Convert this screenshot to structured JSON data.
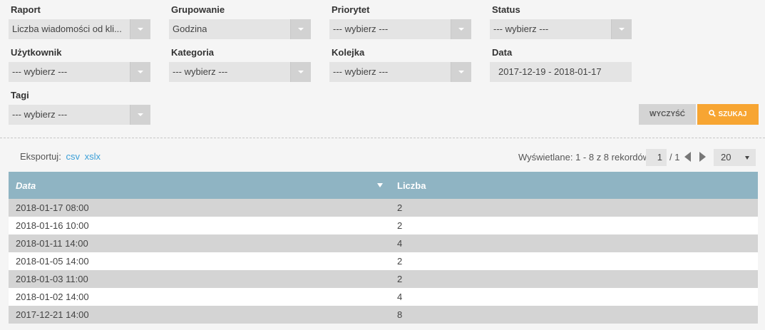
{
  "filters": {
    "raport": {
      "label": "Raport",
      "value": "Liczba wiadomości od kli..."
    },
    "grupowanie": {
      "label": "Grupowanie",
      "value": "Godzina"
    },
    "priorytet": {
      "label": "Priorytet",
      "value": "--- wybierz ---"
    },
    "status": {
      "label": "Status",
      "value": "--- wybierz ---"
    },
    "uzytkownik": {
      "label": "Użytkownik",
      "value": "--- wybierz ---"
    },
    "kategoria": {
      "label": "Kategoria",
      "value": "--- wybierz ---"
    },
    "kolejka": {
      "label": "Kolejka",
      "value": "--- wybierz ---"
    },
    "data": {
      "label": "Data",
      "value": "2017-12-19 - 2018-01-17"
    },
    "tagi": {
      "label": "Tagi",
      "value": "--- wybierz ---"
    }
  },
  "buttons": {
    "clear": "WYCZYŚĆ",
    "search": "SZUKAJ"
  },
  "export": {
    "label": "Eksportuj:",
    "csv": "csv",
    "xslx": "xslx"
  },
  "pager": {
    "summary": "Wyświetlane: 1 - 8 z 8 rekordów",
    "page": "1",
    "total": "/ 1",
    "per_page": "20"
  },
  "table": {
    "columns": [
      "Data",
      "Liczba"
    ],
    "rows": [
      [
        "2018-01-17 08:00",
        "2"
      ],
      [
        "2018-01-16 10:00",
        "2"
      ],
      [
        "2018-01-11 14:00",
        "4"
      ],
      [
        "2018-01-05 14:00",
        "2"
      ],
      [
        "2018-01-03 11:00",
        "2"
      ],
      [
        "2018-01-02 14:00",
        "4"
      ],
      [
        "2017-12-21 14:00",
        "8"
      ]
    ]
  },
  "colors": {
    "accent": "#f7a532",
    "header": "#8fb4c3",
    "link": "#3a9fd8"
  }
}
